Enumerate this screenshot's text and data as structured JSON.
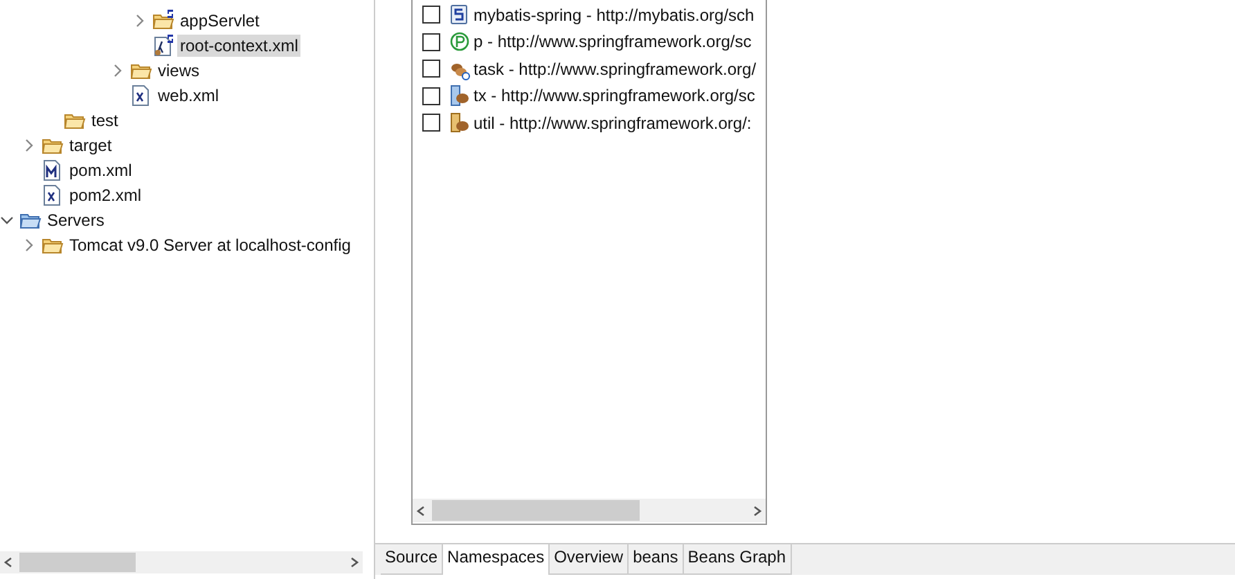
{
  "tree": {
    "items": [
      {
        "label": "appServlet",
        "kind": "spring-folder",
        "expanded": false,
        "selected": false
      },
      {
        "label": "root-context.xml",
        "kind": "spring-xml",
        "selected": true
      },
      {
        "label": "views",
        "kind": "folder",
        "expanded": false,
        "selected": false
      },
      {
        "label": "web.xml",
        "kind": "xml",
        "selected": false
      },
      {
        "label": "test",
        "kind": "folder",
        "selected": false
      },
      {
        "label": "target",
        "kind": "folder",
        "expanded": false,
        "selected": false
      },
      {
        "label": "pom.xml",
        "kind": "maven",
        "selected": false
      },
      {
        "label": "pom2.xml",
        "kind": "xml",
        "selected": false
      },
      {
        "label": "Servers",
        "kind": "servers",
        "expanded": true,
        "selected": false,
        "children": [
          {
            "label": "Tomcat v9.0 Server at localhost-config",
            "kind": "folder",
            "expanded": false,
            "selected": false
          }
        ]
      }
    ]
  },
  "namespaces": [
    {
      "label": "mybatis-spring - http://mybatis.org/sch",
      "kind": "s",
      "checked": false
    },
    {
      "label": "p - http://www.springframework.org/sc",
      "kind": "p",
      "checked": false
    },
    {
      "label": "task - http://www.springframework.org/",
      "kind": "task",
      "checked": false
    },
    {
      "label": "tx - http://www.springframework.org/sc",
      "kind": "tx",
      "checked": false
    },
    {
      "label": "util - http://www.springframework.org/:",
      "kind": "util",
      "checked": false
    }
  ],
  "tabs": [
    {
      "label": "Source",
      "selected": false
    },
    {
      "label": "Namespaces",
      "selected": true
    },
    {
      "label": "Overview",
      "selected": false
    },
    {
      "label": "beans",
      "selected": false
    },
    {
      "label": "Beans Graph",
      "selected": false
    }
  ]
}
